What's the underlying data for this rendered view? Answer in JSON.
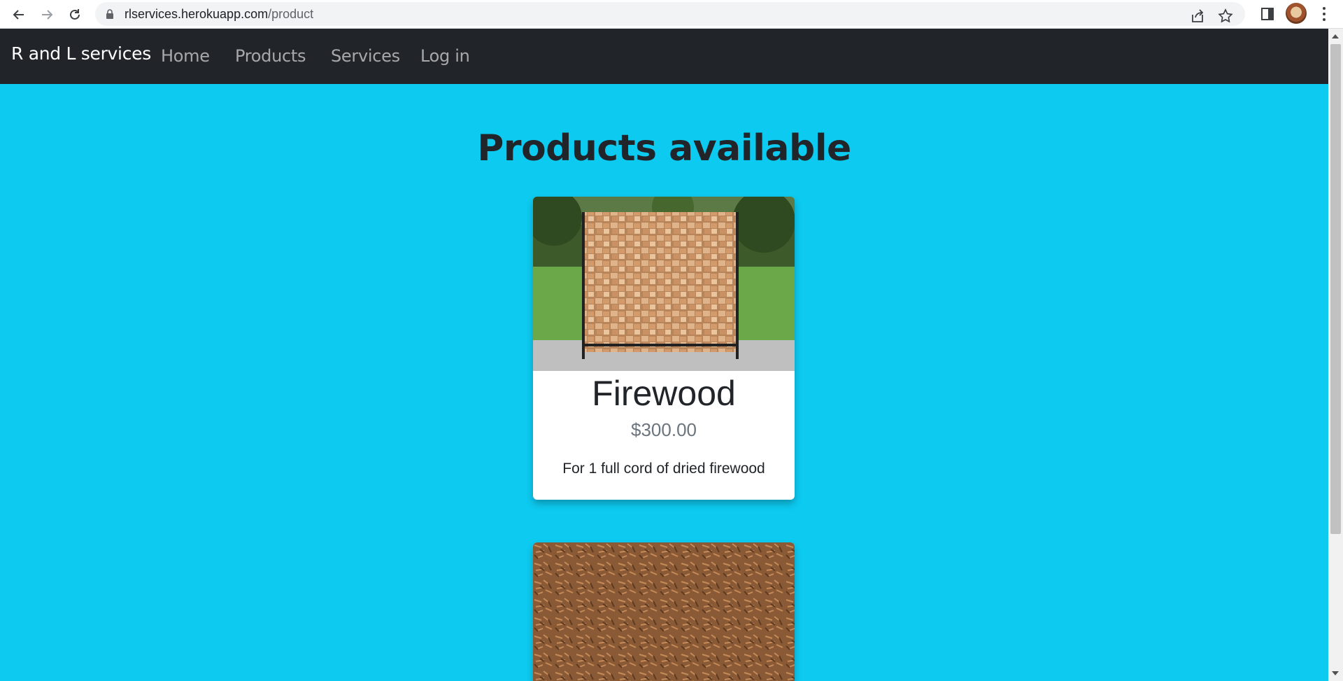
{
  "browser": {
    "url_host": "rlservices.herokuapp.com",
    "url_path": "/product"
  },
  "navbar": {
    "brand": "R and L services",
    "links": [
      {
        "label": "Home"
      },
      {
        "label": "Products"
      },
      {
        "label": "Services"
      },
      {
        "label": "Log in"
      }
    ],
    "background": "#212529"
  },
  "main": {
    "title": "Products available",
    "background": "#0dcaf0"
  },
  "products": [
    {
      "name": "Firewood",
      "price": "$300.00",
      "description": "For 1 full cord of dried firewood",
      "image": "firewood-rack"
    },
    {
      "image": "mulch"
    }
  ]
}
